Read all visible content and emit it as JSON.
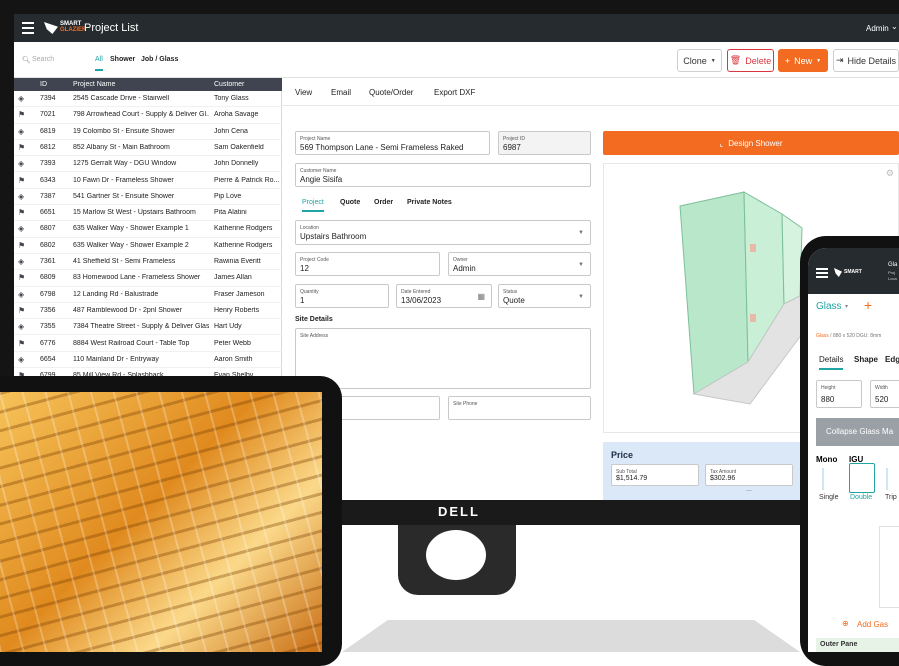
{
  "app": {
    "brand_line1": "SMART",
    "brand_line2": "GLAZIER",
    "title": "Project List",
    "user": "Admin"
  },
  "filters": {
    "search_placeholder": "Search",
    "all": "All",
    "shower": "Shower",
    "job_glass": "Job / Glass"
  },
  "toolbar": {
    "clone": "Clone",
    "delete": "Delete",
    "new": "New",
    "hide_details": "Hide Details"
  },
  "table": {
    "headers": {
      "id": "ID",
      "name": "Project Name",
      "customer": "Customer"
    },
    "rows": [
      {
        "id": "7394",
        "name": "2545 Cascade Drive - Stairwell",
        "customer": "Tony Glass"
      },
      {
        "id": "7021",
        "name": "798 Arrowhead Court - Supply & Deliver Gl...",
        "customer": "Aroha Savage"
      },
      {
        "id": "6819",
        "name": "19 Colombo St - Ensuite Shower",
        "customer": "John Cena"
      },
      {
        "id": "6812",
        "name": "852 Albany St - Main Bathroom",
        "customer": "Sam Oakenfield"
      },
      {
        "id": "7393",
        "name": "1275 Gerralt Way - DGU Window",
        "customer": "John Donnelly"
      },
      {
        "id": "6343",
        "name": "10 Fawn Dr - Frameless Shower",
        "customer": "Pierre & Patrick Ro..."
      },
      {
        "id": "7387",
        "name": "541 Gartner St - Ensuite Shower",
        "customer": "Pip Love"
      },
      {
        "id": "6651",
        "name": "15 Marlow St West - Upstairs Bathroom",
        "customer": "Pita Alatini"
      },
      {
        "id": "6807",
        "name": "635 Walker Way - Shower Example 1",
        "customer": "Katherine Rodgers"
      },
      {
        "id": "6802",
        "name": "635 Walker Way - Shower Example 2",
        "customer": "Katherine Rodgers"
      },
      {
        "id": "7361",
        "name": "41 Sheffield St - Semi Frameless",
        "customer": "Rawinia Everitt"
      },
      {
        "id": "6809",
        "name": "83 Homewood Lane - Frameless Shower",
        "customer": "James Allan"
      },
      {
        "id": "6798",
        "name": "12 Landing Rd - Balustrade",
        "customer": "Fraser Jameson"
      },
      {
        "id": "7356",
        "name": "487 Ramblewood Dr - 2pnl Shower",
        "customer": "Henry Roberts"
      },
      {
        "id": "7355",
        "name": "7384 Theatre Street - Supply & Deliver Glas",
        "customer": "Hart Udy"
      },
      {
        "id": "6776",
        "name": "8884 West Railroad Court - Table Top",
        "customer": "Peter Webb"
      },
      {
        "id": "6654",
        "name": "110 Mainland Dr - Entryway",
        "customer": "Aaron Smith"
      },
      {
        "id": "6799",
        "name": "85 Mill View Rd - Splashback",
        "customer": "Evan Shelby"
      }
    ]
  },
  "detail": {
    "tabs": {
      "view": "View",
      "email": "Email",
      "quote_order": "Quote/Order",
      "export": "Export DXF"
    },
    "project_name_label": "Project Name",
    "project_name": "569 Thompson Lane - Semi Frameless Raked",
    "project_id_label": "Project ID",
    "project_id": "6987",
    "customer_label": "Customer Name",
    "customer": "Angie Sisifa",
    "subtabs": {
      "project": "Project",
      "quote": "Quote",
      "order": "Order",
      "notes": "Private Notes"
    },
    "location_label": "Location",
    "location": "Upstairs Bathroom",
    "code_label": "Project Code",
    "code": "12",
    "owner_label": "Owner",
    "owner": "Admin",
    "qty_label": "Quantity",
    "qty": "1",
    "date_label": "Date Entered",
    "date": "13/06/2023",
    "status_label": "Status",
    "status": "Quote",
    "site_details": "Site Details",
    "site_address_label": "Site Address",
    "site_phone_label": "Site Phone",
    "design_button": "Design Shower",
    "price_title": "Price",
    "subtotal_label": "Sub Total",
    "subtotal": "$1,514.79",
    "tax_label": "Tax Amount",
    "tax": "$302.96",
    "more": "..."
  },
  "monitor": {
    "brand": "DELL"
  },
  "phone": {
    "header1": "Gla",
    "header2": "Proj",
    "header3": "Loca",
    "glass_dropdown": "Glass",
    "crumb_link": "Glass",
    "crumb_rest": " / 880 x 520 DGU: 8mm",
    "tabs": {
      "details": "Details",
      "shape": "Shape",
      "edge": "Edg"
    },
    "height_label": "Height",
    "height": "880",
    "width_label": "Width",
    "width": "520",
    "collapse": "Collapse Glass Ma",
    "mono": "Mono",
    "igu": "IGU",
    "single": "Single",
    "double": "Double",
    "triple": "Trip",
    "add_gas": "Add Gas",
    "outer_pane": "Outer Pane"
  },
  "colors": {
    "accent": "#f26b21",
    "header": "#262b30",
    "table_head": "#3f4450",
    "delete": "#d9363e",
    "teal": "#20a4a4",
    "price_bg": "#dbe8f8"
  }
}
